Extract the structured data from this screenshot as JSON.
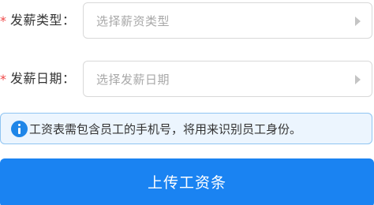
{
  "form": {
    "required_mark": "*",
    "type_field": {
      "label": "发薪类型：",
      "placeholder": "选择薪资类型"
    },
    "date_field": {
      "label": "发薪日期：",
      "placeholder": "选择发薪日期"
    }
  },
  "notice": {
    "icon": "info-icon",
    "text": "工资表需包含员工的手机号，将用来识别员工身份。",
    "colors": {
      "background": "#ecf5fe",
      "border": "#8fc4f2",
      "icon": "#1f86e8"
    }
  },
  "upload_button": {
    "label": "上传工资条",
    "color": "#1a83f2"
  },
  "colors": {
    "required": "#f04848"
  }
}
